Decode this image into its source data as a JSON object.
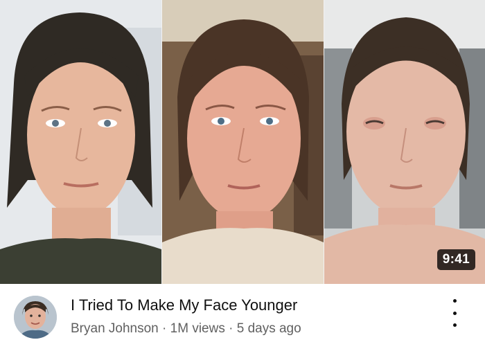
{
  "video": {
    "duration": "9:41",
    "title": "I Tried To Make My Face Younger",
    "channel": "Bryan Johnson",
    "separator": "·",
    "views": "1M views",
    "age": "5 days ago"
  },
  "icons": {
    "more": "more-vert-icon",
    "avatar": "channel-avatar"
  },
  "colors": {
    "title": "#0f0f0f",
    "meta": "#606060",
    "duration_badge_bg": "#000000",
    "background": "#ffffff"
  }
}
